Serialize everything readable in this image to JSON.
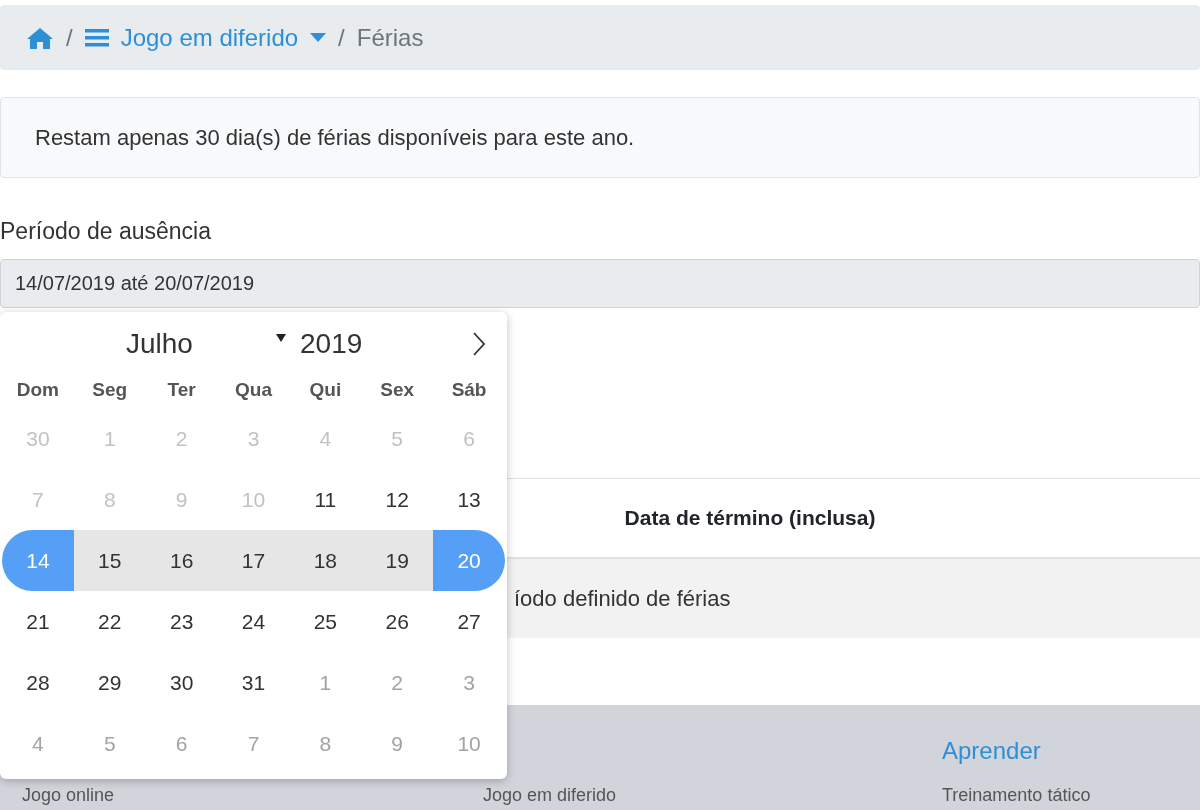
{
  "breadcrumb": {
    "separator": "/",
    "section": "Jogo em diferido",
    "separator_2": "/",
    "current": "Férias"
  },
  "alert": "Restam apenas 30 dia(s) de férias disponíveis para este ano.",
  "period_field": {
    "label": "Período de ausência",
    "value": "14/07/2019 até 20/07/2019"
  },
  "table": {
    "columns": [
      "Data de término (inclusa)"
    ],
    "rows": [
      [
        "íodo definido de férias"
      ]
    ]
  },
  "footer": {
    "headings": [
      "Aprender"
    ],
    "links": [
      "Jogo online",
      "Jogo em diferido",
      "Treinamento tático"
    ]
  },
  "calendar": {
    "month": "Julho",
    "year": "2019",
    "weekdays": [
      "Dom",
      "Seg",
      "Ter",
      "Qua",
      "Qui",
      "Sex",
      "Sáb"
    ],
    "weeks": [
      [
        {
          "day": "30",
          "kind": "disabled"
        },
        {
          "day": "1",
          "kind": "disabled"
        },
        {
          "day": "2",
          "kind": "disabled"
        },
        {
          "day": "3",
          "kind": "disabled"
        },
        {
          "day": "4",
          "kind": "disabled"
        },
        {
          "day": "5",
          "kind": "disabled"
        },
        {
          "day": "6",
          "kind": "disabled"
        }
      ],
      [
        {
          "day": "7",
          "kind": "disabled"
        },
        {
          "day": "8",
          "kind": "disabled"
        },
        {
          "day": "9",
          "kind": "disabled"
        },
        {
          "day": "10",
          "kind": "disabled"
        },
        {
          "day": "11",
          "kind": "normal"
        },
        {
          "day": "12",
          "kind": "normal"
        },
        {
          "day": "13",
          "kind": "normal"
        }
      ],
      [
        {
          "day": "14",
          "kind": "start"
        },
        {
          "day": "15",
          "kind": "range"
        },
        {
          "day": "16",
          "kind": "range"
        },
        {
          "day": "17",
          "kind": "range"
        },
        {
          "day": "18",
          "kind": "range"
        },
        {
          "day": "19",
          "kind": "range"
        },
        {
          "day": "20",
          "kind": "end"
        }
      ],
      [
        {
          "day": "21",
          "kind": "normal"
        },
        {
          "day": "22",
          "kind": "normal"
        },
        {
          "day": "23",
          "kind": "normal"
        },
        {
          "day": "24",
          "kind": "normal"
        },
        {
          "day": "25",
          "kind": "normal"
        },
        {
          "day": "26",
          "kind": "normal"
        },
        {
          "day": "27",
          "kind": "normal"
        }
      ],
      [
        {
          "day": "28",
          "kind": "normal"
        },
        {
          "day": "29",
          "kind": "normal"
        },
        {
          "day": "30",
          "kind": "normal"
        },
        {
          "day": "31",
          "kind": "normal"
        },
        {
          "day": "1",
          "kind": "outside"
        },
        {
          "day": "2",
          "kind": "outside"
        },
        {
          "day": "3",
          "kind": "outside"
        }
      ],
      [
        {
          "day": "4",
          "kind": "outside"
        },
        {
          "day": "5",
          "kind": "outside"
        },
        {
          "day": "6",
          "kind": "outside"
        },
        {
          "day": "7",
          "kind": "outside"
        },
        {
          "day": "8",
          "kind": "outside"
        },
        {
          "day": "9",
          "kind": "outside"
        },
        {
          "day": "10",
          "kind": "outside"
        }
      ]
    ]
  }
}
